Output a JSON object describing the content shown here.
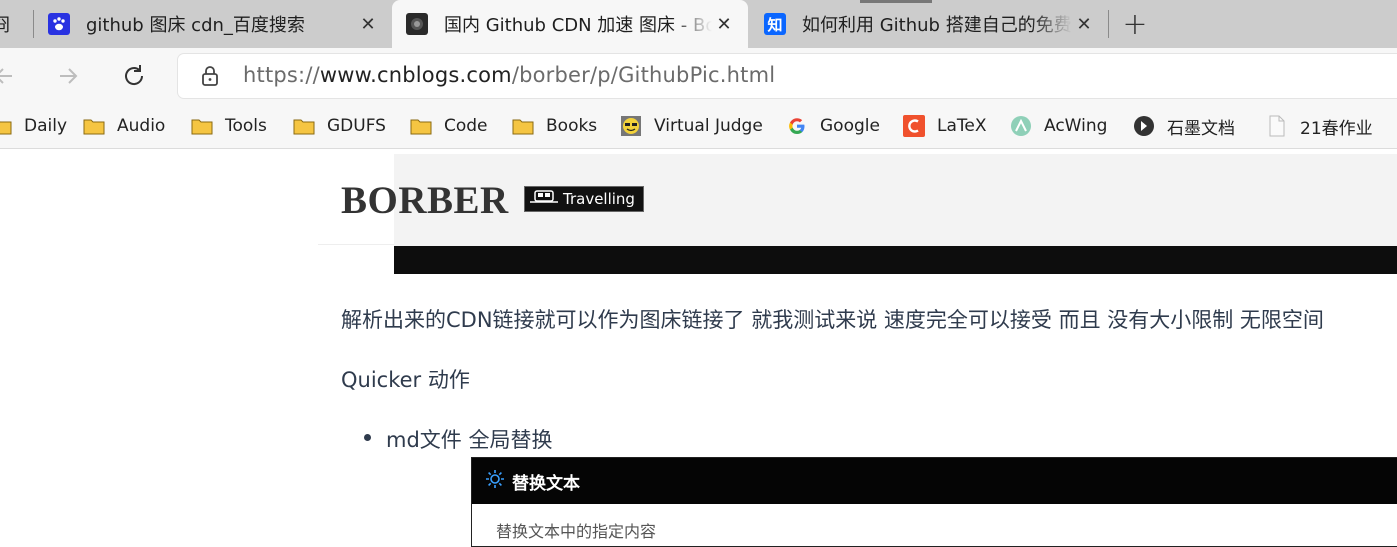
{
  "tabs": [
    {
      "title": "github 图床 cdn_百度搜索",
      "favicon": "baidu-paw-icon"
    },
    {
      "title": "国内 Github CDN 加速 图床 - Borber",
      "favicon": "cnblogs-avatar-icon",
      "active": true
    },
    {
      "title": "如何利用 Github 搭建自己的免费图床",
      "favicon": "zhihu-icon"
    }
  ],
  "tab_close_glyph": "✕",
  "first_tab_glyph": "冏",
  "new_tab_glyph": "+",
  "address": {
    "scheme": "https://",
    "host": "www.cnblogs.com",
    "path": "/borber/p/GithubPic.html"
  },
  "bookmarks": [
    {
      "label": "Daily",
      "icon": "folder-icon"
    },
    {
      "label": "Audio",
      "icon": "folder-icon"
    },
    {
      "label": "Tools",
      "icon": "folder-icon"
    },
    {
      "label": "GDUFS",
      "icon": "folder-icon"
    },
    {
      "label": "Code",
      "icon": "folder-icon"
    },
    {
      "label": "Books",
      "icon": "folder-icon"
    },
    {
      "label": "Virtual Judge",
      "icon": "virtual-judge-icon"
    },
    {
      "label": "Google",
      "icon": "google-icon"
    },
    {
      "label": "LaTeX",
      "icon": "latex-icon"
    },
    {
      "label": "AcWing",
      "icon": "acwing-icon"
    },
    {
      "label": "石墨文档",
      "icon": "shimo-icon"
    },
    {
      "label": "21春作业",
      "icon": "document-icon"
    }
  ],
  "blog": {
    "title": "BORBER",
    "badge": "Travelling"
  },
  "content": {
    "paragraph1": "解析出来的CDN链接就可以作为图床链接了 就我测试来说 速度完全可以接受 而且 没有大小限制 无限空间",
    "paragraph2": "Quicker 动作",
    "list_item": "md文件 全局替换",
    "screenshot_title": "替换文本",
    "screenshot_subtitle": "替换文本中的指定内容"
  },
  "colors": {
    "folder": "#f5c542",
    "accent_dark": "#0d0d0d",
    "text": "#2f3b4d"
  }
}
